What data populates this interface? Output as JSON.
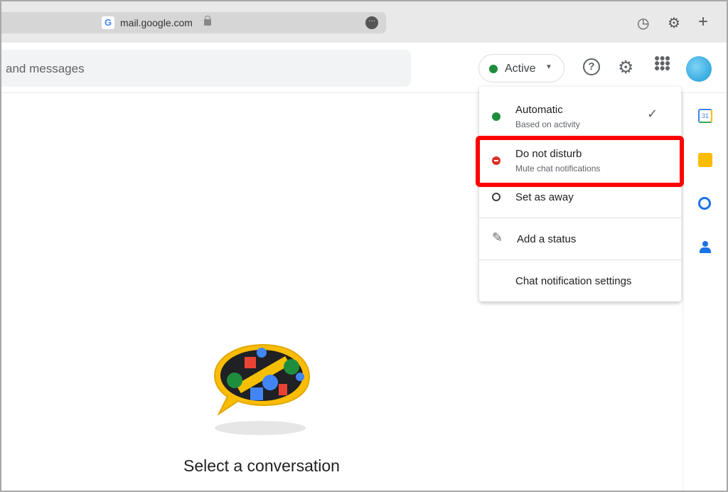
{
  "browser": {
    "url": "mail.google.com",
    "icons": [
      "history-icon",
      "settings-icon",
      "plus-icon"
    ]
  },
  "search": {
    "placeholder": "and messages"
  },
  "status_button": {
    "label": "Active",
    "color": "#1e8e3e"
  },
  "header_icons": [
    "help-icon",
    "settings-icon",
    "apps-icon",
    "avatar"
  ],
  "status_menu": {
    "items": [
      {
        "title": "Automatic",
        "subtitle": "Based on activity",
        "selected": true,
        "color": "#1e8e3e"
      },
      {
        "title": "Do not disturb",
        "subtitle": "Mute chat notifications",
        "color": "#d93025",
        "highlighted": true
      },
      {
        "title": "Set as away"
      },
      {
        "title": "Add a status"
      },
      {
        "title": "Chat notification settings"
      }
    ]
  },
  "side_panel": {
    "calendar_day": "31",
    "apps": [
      "calendar",
      "keep",
      "tasks",
      "contacts"
    ]
  },
  "highlight_color": "#ff0000",
  "main": {
    "empty_text": "Select a conversation"
  }
}
